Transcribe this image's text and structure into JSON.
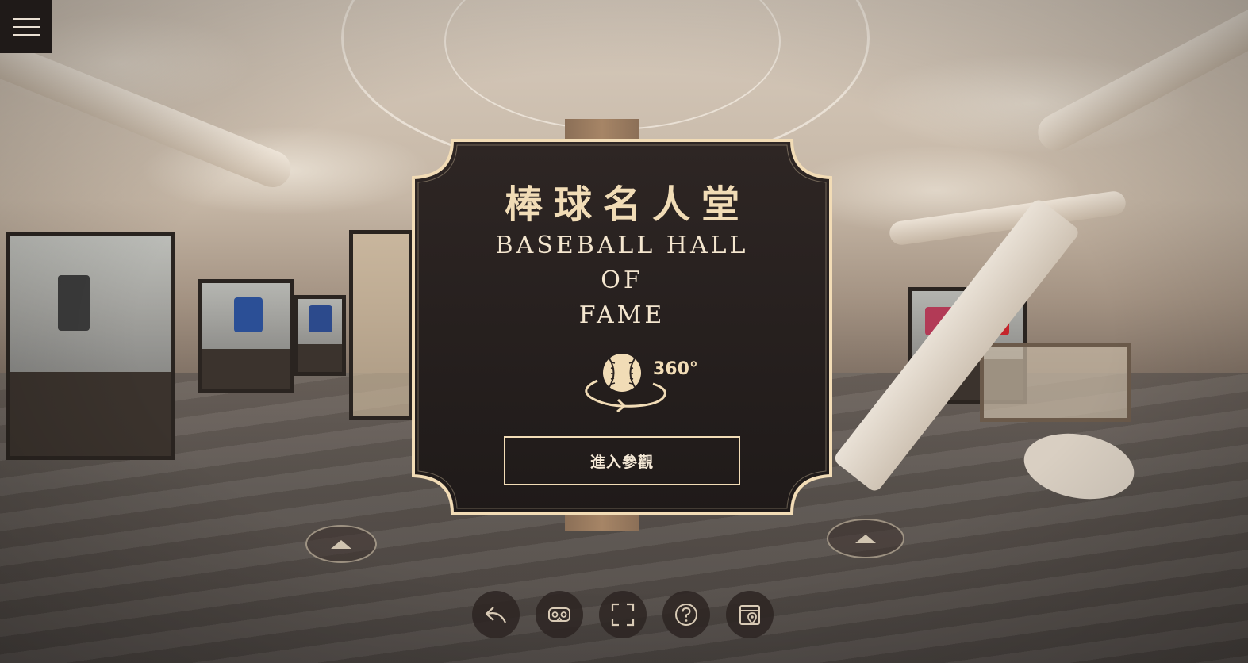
{
  "menu": {
    "icon": "hamburger-menu-icon"
  },
  "card": {
    "title_zh": "棒球名人堂",
    "title_en_lines": [
      "BASEBALL HALL",
      "OF",
      "FAME"
    ],
    "pano_label": "360°",
    "enter_label": "進入參觀",
    "colors": {
      "frame": "#f2dcb6",
      "panel": "#2a2321",
      "text": "#f1dcb6"
    }
  },
  "hotspots": [
    {
      "icon": "move-forward-arrow-icon"
    },
    {
      "icon": "move-forward-arrow-icon"
    }
  ],
  "toolbar": [
    {
      "icon": "back-arrow-icon"
    },
    {
      "icon": "vr-goggles-icon"
    },
    {
      "icon": "fullscreen-icon"
    },
    {
      "icon": "help-icon"
    },
    {
      "icon": "map-location-icon"
    }
  ]
}
